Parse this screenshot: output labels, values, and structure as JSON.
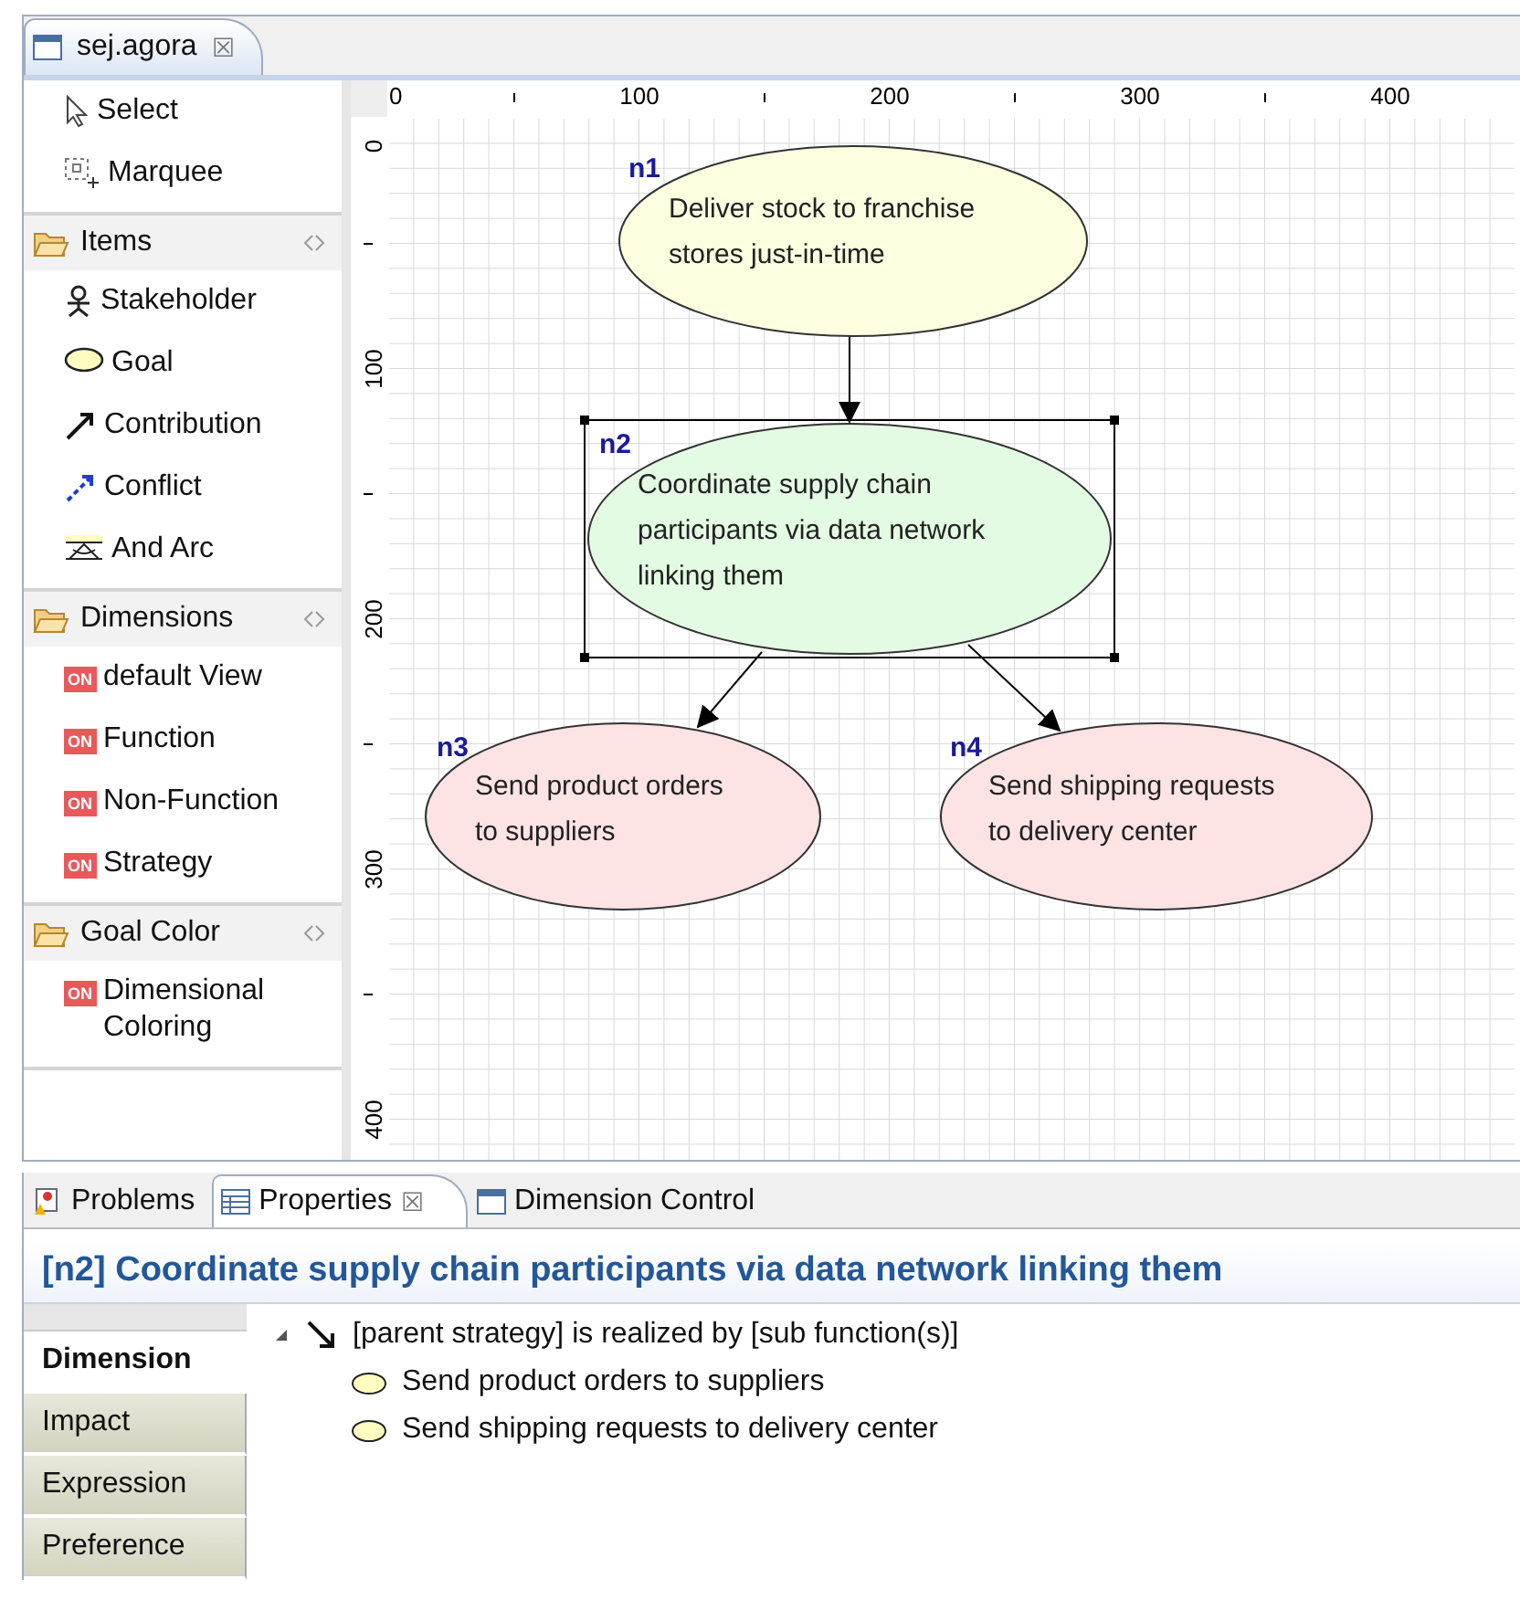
{
  "editor_tab": {
    "title": "sej.agora",
    "close": "☒"
  },
  "palette": {
    "tools": [
      {
        "kind": "select",
        "label": "Select"
      },
      {
        "kind": "marquee",
        "label": "Marquee"
      }
    ],
    "drawers": [
      {
        "title": "Items",
        "items": [
          {
            "kind": "stakeholder",
            "label": "Stakeholder"
          },
          {
            "kind": "goal",
            "label": "Goal"
          },
          {
            "kind": "contribution",
            "label": "Contribution"
          },
          {
            "kind": "conflict",
            "label": "Conflict"
          },
          {
            "kind": "andarc",
            "label": "And Arc"
          }
        ]
      },
      {
        "title": "Dimensions",
        "items": [
          {
            "kind": "toggle",
            "badge": "ON",
            "label": "default View"
          },
          {
            "kind": "toggle",
            "badge": "ON",
            "label": "Function"
          },
          {
            "kind": "toggle",
            "badge": "ON",
            "label": "Non-Function"
          },
          {
            "kind": "toggle",
            "badge": "ON",
            "label": "Strategy"
          }
        ]
      },
      {
        "title": "Goal Color",
        "items": [
          {
            "kind": "toggle",
            "badge": "ON",
            "label": "Dimensional Coloring"
          }
        ]
      }
    ]
  },
  "ruler_h": [
    "0",
    "100",
    "200",
    "300",
    "400"
  ],
  "ruler_v": [
    "0",
    "100",
    "200",
    "300",
    "400"
  ],
  "nodes": [
    {
      "id": "n1",
      "lines": [
        "Deliver stock to franchise",
        "stores just-in-time"
      ],
      "color": "#fdfde0",
      "selected": false
    },
    {
      "id": "n2",
      "lines": [
        "Coordinate supply chain",
        "participants via data network",
        "linking them"
      ],
      "color": "#e3fbe3",
      "selected": true
    },
    {
      "id": "n3",
      "lines": [
        "Send product orders",
        "to suppliers"
      ],
      "color": "#fde3e3",
      "selected": false
    },
    {
      "id": "n4",
      "lines": [
        "Send shipping requests",
        "to delivery center"
      ],
      "color": "#fde3e3",
      "selected": false
    }
  ],
  "bottom_tabs": [
    {
      "kind": "problems",
      "label": "Problems",
      "selected": false
    },
    {
      "kind": "properties",
      "label": "Properties",
      "selected": true,
      "close": "☒"
    },
    {
      "kind": "window",
      "label": "Dimension Control",
      "selected": false
    }
  ],
  "properties_title": "[n2] Coordinate supply chain participants via data network linking them",
  "side_tabs": [
    {
      "label": "Dimension",
      "selected": true
    },
    {
      "label": "Impact",
      "selected": false
    },
    {
      "label": "Expression",
      "selected": false
    },
    {
      "label": "Preference",
      "selected": false
    }
  ],
  "tree": {
    "label": "[parent strategy] is realized by [sub function(s)]",
    "expanded": true,
    "children": [
      {
        "label": "Send product orders to suppliers"
      },
      {
        "label": "Send shipping requests to delivery center"
      }
    ]
  }
}
